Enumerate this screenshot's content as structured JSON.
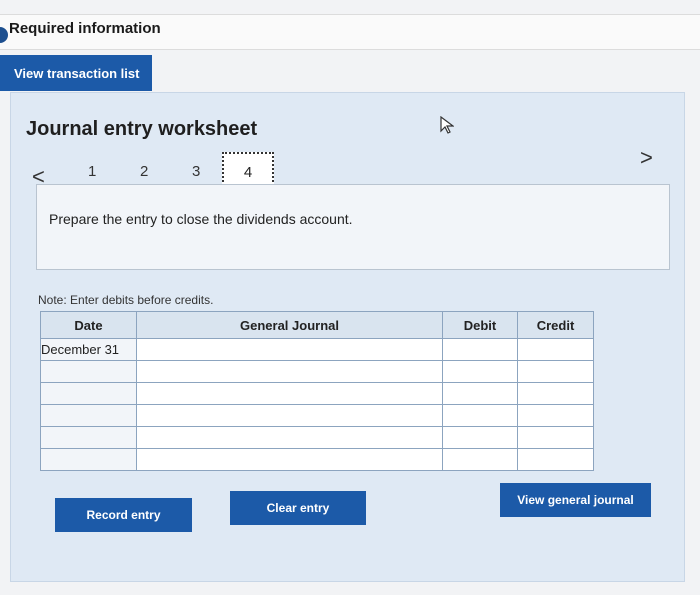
{
  "header": {
    "title": "Required information"
  },
  "toolbar": {
    "view_transactions_label": "View transaction list"
  },
  "worksheet": {
    "title": "Journal entry worksheet",
    "steps": [
      "1",
      "2",
      "3",
      "4"
    ],
    "active_step": "4",
    "instruction": "Prepare the entry to close the dividends account.",
    "note": "Note: Enter debits before credits."
  },
  "table": {
    "headers": {
      "date": "Date",
      "journal": "General Journal",
      "debit": "Debit",
      "credit": "Credit"
    },
    "rows": [
      {
        "date": "December 31",
        "account": "",
        "debit": "",
        "credit": ""
      },
      {
        "date": "",
        "account": "",
        "debit": "",
        "credit": ""
      },
      {
        "date": "",
        "account": "",
        "debit": "",
        "credit": ""
      },
      {
        "date": "",
        "account": "",
        "debit": "",
        "credit": ""
      },
      {
        "date": "",
        "account": "",
        "debit": "",
        "credit": ""
      },
      {
        "date": "",
        "account": "",
        "debit": "",
        "credit": ""
      }
    ]
  },
  "buttons": {
    "record": "Record entry",
    "clear": "Clear entry",
    "view_journal": "View general journal"
  },
  "nav": {
    "prev": "<",
    "next": ">"
  },
  "colors": {
    "accent": "#1c5aa8",
    "panel": "#dfe9f4"
  }
}
